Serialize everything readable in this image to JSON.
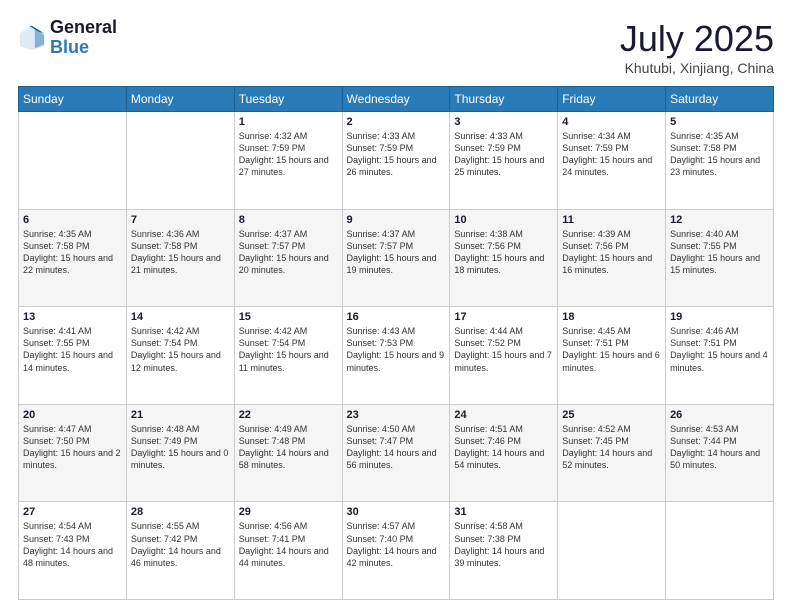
{
  "logo": {
    "general": "General",
    "blue": "Blue"
  },
  "title": {
    "month_year": "July 2025",
    "location": "Khutubi, Xinjiang, China"
  },
  "weekdays": [
    "Sunday",
    "Monday",
    "Tuesday",
    "Wednesday",
    "Thursday",
    "Friday",
    "Saturday"
  ],
  "weeks": [
    [
      {
        "day": "",
        "text": ""
      },
      {
        "day": "",
        "text": ""
      },
      {
        "day": "1",
        "text": "Sunrise: 4:32 AM\nSunset: 7:59 PM\nDaylight: 15 hours\nand 27 minutes."
      },
      {
        "day": "2",
        "text": "Sunrise: 4:33 AM\nSunset: 7:59 PM\nDaylight: 15 hours\nand 26 minutes."
      },
      {
        "day": "3",
        "text": "Sunrise: 4:33 AM\nSunset: 7:59 PM\nDaylight: 15 hours\nand 25 minutes."
      },
      {
        "day": "4",
        "text": "Sunrise: 4:34 AM\nSunset: 7:59 PM\nDaylight: 15 hours\nand 24 minutes."
      },
      {
        "day": "5",
        "text": "Sunrise: 4:35 AM\nSunset: 7:58 PM\nDaylight: 15 hours\nand 23 minutes."
      }
    ],
    [
      {
        "day": "6",
        "text": "Sunrise: 4:35 AM\nSunset: 7:58 PM\nDaylight: 15 hours\nand 22 minutes."
      },
      {
        "day": "7",
        "text": "Sunrise: 4:36 AM\nSunset: 7:58 PM\nDaylight: 15 hours\nand 21 minutes."
      },
      {
        "day": "8",
        "text": "Sunrise: 4:37 AM\nSunset: 7:57 PM\nDaylight: 15 hours\nand 20 minutes."
      },
      {
        "day": "9",
        "text": "Sunrise: 4:37 AM\nSunset: 7:57 PM\nDaylight: 15 hours\nand 19 minutes."
      },
      {
        "day": "10",
        "text": "Sunrise: 4:38 AM\nSunset: 7:56 PM\nDaylight: 15 hours\nand 18 minutes."
      },
      {
        "day": "11",
        "text": "Sunrise: 4:39 AM\nSunset: 7:56 PM\nDaylight: 15 hours\nand 16 minutes."
      },
      {
        "day": "12",
        "text": "Sunrise: 4:40 AM\nSunset: 7:55 PM\nDaylight: 15 hours\nand 15 minutes."
      }
    ],
    [
      {
        "day": "13",
        "text": "Sunrise: 4:41 AM\nSunset: 7:55 PM\nDaylight: 15 hours\nand 14 minutes."
      },
      {
        "day": "14",
        "text": "Sunrise: 4:42 AM\nSunset: 7:54 PM\nDaylight: 15 hours\nand 12 minutes."
      },
      {
        "day": "15",
        "text": "Sunrise: 4:42 AM\nSunset: 7:54 PM\nDaylight: 15 hours\nand 11 minutes."
      },
      {
        "day": "16",
        "text": "Sunrise: 4:43 AM\nSunset: 7:53 PM\nDaylight: 15 hours\nand 9 minutes."
      },
      {
        "day": "17",
        "text": "Sunrise: 4:44 AM\nSunset: 7:52 PM\nDaylight: 15 hours\nand 7 minutes."
      },
      {
        "day": "18",
        "text": "Sunrise: 4:45 AM\nSunset: 7:51 PM\nDaylight: 15 hours\nand 6 minutes."
      },
      {
        "day": "19",
        "text": "Sunrise: 4:46 AM\nSunset: 7:51 PM\nDaylight: 15 hours\nand 4 minutes."
      }
    ],
    [
      {
        "day": "20",
        "text": "Sunrise: 4:47 AM\nSunset: 7:50 PM\nDaylight: 15 hours\nand 2 minutes."
      },
      {
        "day": "21",
        "text": "Sunrise: 4:48 AM\nSunset: 7:49 PM\nDaylight: 15 hours\nand 0 minutes."
      },
      {
        "day": "22",
        "text": "Sunrise: 4:49 AM\nSunset: 7:48 PM\nDaylight: 14 hours\nand 58 minutes."
      },
      {
        "day": "23",
        "text": "Sunrise: 4:50 AM\nSunset: 7:47 PM\nDaylight: 14 hours\nand 56 minutes."
      },
      {
        "day": "24",
        "text": "Sunrise: 4:51 AM\nSunset: 7:46 PM\nDaylight: 14 hours\nand 54 minutes."
      },
      {
        "day": "25",
        "text": "Sunrise: 4:52 AM\nSunset: 7:45 PM\nDaylight: 14 hours\nand 52 minutes."
      },
      {
        "day": "26",
        "text": "Sunrise: 4:53 AM\nSunset: 7:44 PM\nDaylight: 14 hours\nand 50 minutes."
      }
    ],
    [
      {
        "day": "27",
        "text": "Sunrise: 4:54 AM\nSunset: 7:43 PM\nDaylight: 14 hours\nand 48 minutes."
      },
      {
        "day": "28",
        "text": "Sunrise: 4:55 AM\nSunset: 7:42 PM\nDaylight: 14 hours\nand 46 minutes."
      },
      {
        "day": "29",
        "text": "Sunrise: 4:56 AM\nSunset: 7:41 PM\nDaylight: 14 hours\nand 44 minutes."
      },
      {
        "day": "30",
        "text": "Sunrise: 4:57 AM\nSunset: 7:40 PM\nDaylight: 14 hours\nand 42 minutes."
      },
      {
        "day": "31",
        "text": "Sunrise: 4:58 AM\nSunset: 7:38 PM\nDaylight: 14 hours\nand 39 minutes."
      },
      {
        "day": "",
        "text": ""
      },
      {
        "day": "",
        "text": ""
      }
    ]
  ]
}
